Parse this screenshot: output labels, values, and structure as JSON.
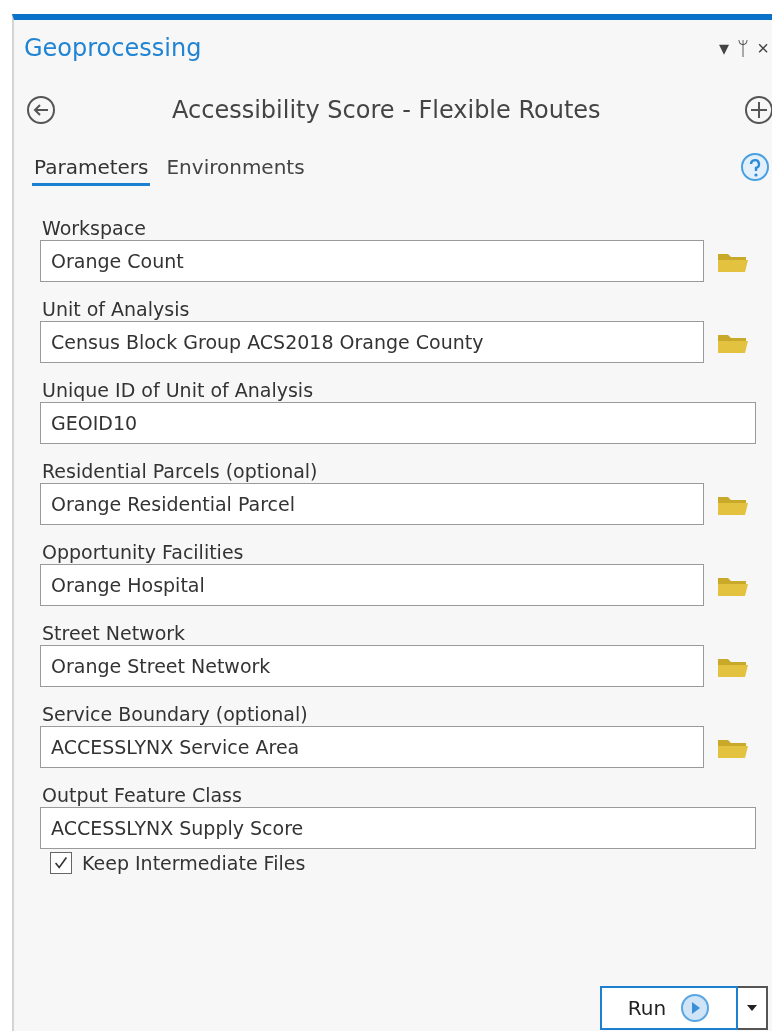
{
  "pane": {
    "title": "Geoprocessing",
    "controls": [
      "▾",
      "ᛘ",
      "×"
    ]
  },
  "tool": {
    "title": "Accessibility Score - Flexible Routes"
  },
  "tabs": [
    {
      "label": "Parameters",
      "selected": true
    },
    {
      "label": "Environments",
      "selected": false
    }
  ],
  "parameters": [
    {
      "label": "Workspace",
      "value": "Orange Count",
      "browse": true
    },
    {
      "label": "Unit of Analysis",
      "value": "Census Block Group ACS2018 Orange County",
      "browse": true
    },
    {
      "label": "Unique ID of Unit of Analysis",
      "value": "GEOID10",
      "browse": false
    },
    {
      "label": "Residential Parcels (optional)",
      "value": "Orange Residential Parcel",
      "browse": true
    },
    {
      "label": "Opportunity Facilities",
      "value": "Orange Hospital",
      "browse": true
    },
    {
      "label": "Street Network",
      "value": "Orange Street Network",
      "browse": true
    },
    {
      "label": "Service Boundary (optional)",
      "value": "ACCESSLYNX Service Area",
      "browse": true
    },
    {
      "label": "Output Feature Class",
      "value": "ACCESSLYNX Supply Score",
      "browse": false
    }
  ],
  "options": [
    {
      "label": "Keep Intermediate Files",
      "checked": true
    }
  ],
  "run_button": {
    "label": "Run"
  }
}
